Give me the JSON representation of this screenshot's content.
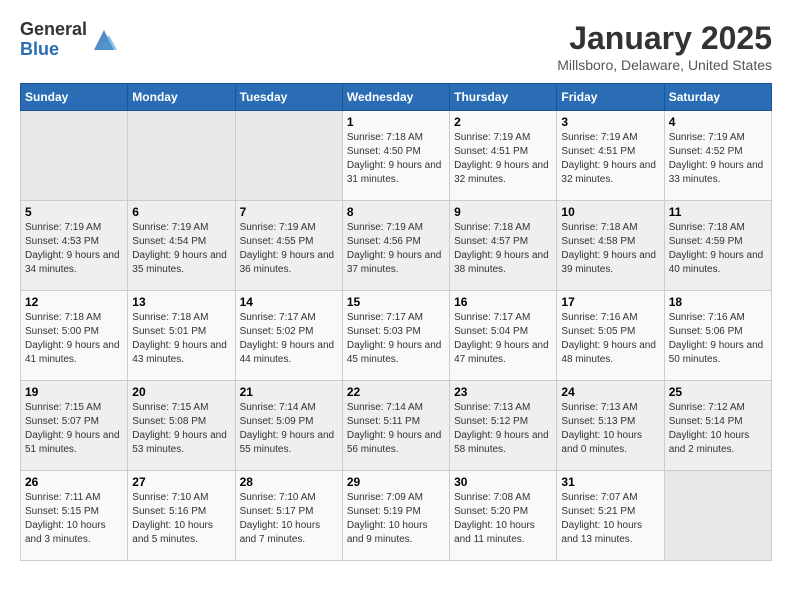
{
  "header": {
    "logo_general": "General",
    "logo_blue": "Blue",
    "title": "January 2025",
    "location": "Millsboro, Delaware, United States"
  },
  "weekdays": [
    "Sunday",
    "Monday",
    "Tuesday",
    "Wednesday",
    "Thursday",
    "Friday",
    "Saturday"
  ],
  "weeks": [
    [
      {
        "day": "",
        "info": ""
      },
      {
        "day": "",
        "info": ""
      },
      {
        "day": "",
        "info": ""
      },
      {
        "day": "1",
        "info": "Sunrise: 7:18 AM\nSunset: 4:50 PM\nDaylight: 9 hours and 31 minutes."
      },
      {
        "day": "2",
        "info": "Sunrise: 7:19 AM\nSunset: 4:51 PM\nDaylight: 9 hours and 32 minutes."
      },
      {
        "day": "3",
        "info": "Sunrise: 7:19 AM\nSunset: 4:51 PM\nDaylight: 9 hours and 32 minutes."
      },
      {
        "day": "4",
        "info": "Sunrise: 7:19 AM\nSunset: 4:52 PM\nDaylight: 9 hours and 33 minutes."
      }
    ],
    [
      {
        "day": "5",
        "info": "Sunrise: 7:19 AM\nSunset: 4:53 PM\nDaylight: 9 hours and 34 minutes."
      },
      {
        "day": "6",
        "info": "Sunrise: 7:19 AM\nSunset: 4:54 PM\nDaylight: 9 hours and 35 minutes."
      },
      {
        "day": "7",
        "info": "Sunrise: 7:19 AM\nSunset: 4:55 PM\nDaylight: 9 hours and 36 minutes."
      },
      {
        "day": "8",
        "info": "Sunrise: 7:19 AM\nSunset: 4:56 PM\nDaylight: 9 hours and 37 minutes."
      },
      {
        "day": "9",
        "info": "Sunrise: 7:18 AM\nSunset: 4:57 PM\nDaylight: 9 hours and 38 minutes."
      },
      {
        "day": "10",
        "info": "Sunrise: 7:18 AM\nSunset: 4:58 PM\nDaylight: 9 hours and 39 minutes."
      },
      {
        "day": "11",
        "info": "Sunrise: 7:18 AM\nSunset: 4:59 PM\nDaylight: 9 hours and 40 minutes."
      }
    ],
    [
      {
        "day": "12",
        "info": "Sunrise: 7:18 AM\nSunset: 5:00 PM\nDaylight: 9 hours and 41 minutes."
      },
      {
        "day": "13",
        "info": "Sunrise: 7:18 AM\nSunset: 5:01 PM\nDaylight: 9 hours and 43 minutes."
      },
      {
        "day": "14",
        "info": "Sunrise: 7:17 AM\nSunset: 5:02 PM\nDaylight: 9 hours and 44 minutes."
      },
      {
        "day": "15",
        "info": "Sunrise: 7:17 AM\nSunset: 5:03 PM\nDaylight: 9 hours and 45 minutes."
      },
      {
        "day": "16",
        "info": "Sunrise: 7:17 AM\nSunset: 5:04 PM\nDaylight: 9 hours and 47 minutes."
      },
      {
        "day": "17",
        "info": "Sunrise: 7:16 AM\nSunset: 5:05 PM\nDaylight: 9 hours and 48 minutes."
      },
      {
        "day": "18",
        "info": "Sunrise: 7:16 AM\nSunset: 5:06 PM\nDaylight: 9 hours and 50 minutes."
      }
    ],
    [
      {
        "day": "19",
        "info": "Sunrise: 7:15 AM\nSunset: 5:07 PM\nDaylight: 9 hours and 51 minutes."
      },
      {
        "day": "20",
        "info": "Sunrise: 7:15 AM\nSunset: 5:08 PM\nDaylight: 9 hours and 53 minutes."
      },
      {
        "day": "21",
        "info": "Sunrise: 7:14 AM\nSunset: 5:09 PM\nDaylight: 9 hours and 55 minutes."
      },
      {
        "day": "22",
        "info": "Sunrise: 7:14 AM\nSunset: 5:11 PM\nDaylight: 9 hours and 56 minutes."
      },
      {
        "day": "23",
        "info": "Sunrise: 7:13 AM\nSunset: 5:12 PM\nDaylight: 9 hours and 58 minutes."
      },
      {
        "day": "24",
        "info": "Sunrise: 7:13 AM\nSunset: 5:13 PM\nDaylight: 10 hours and 0 minutes."
      },
      {
        "day": "25",
        "info": "Sunrise: 7:12 AM\nSunset: 5:14 PM\nDaylight: 10 hours and 2 minutes."
      }
    ],
    [
      {
        "day": "26",
        "info": "Sunrise: 7:11 AM\nSunset: 5:15 PM\nDaylight: 10 hours and 3 minutes."
      },
      {
        "day": "27",
        "info": "Sunrise: 7:10 AM\nSunset: 5:16 PM\nDaylight: 10 hours and 5 minutes."
      },
      {
        "day": "28",
        "info": "Sunrise: 7:10 AM\nSunset: 5:17 PM\nDaylight: 10 hours and 7 minutes."
      },
      {
        "day": "29",
        "info": "Sunrise: 7:09 AM\nSunset: 5:19 PM\nDaylight: 10 hours and 9 minutes."
      },
      {
        "day": "30",
        "info": "Sunrise: 7:08 AM\nSunset: 5:20 PM\nDaylight: 10 hours and 11 minutes."
      },
      {
        "day": "31",
        "info": "Sunrise: 7:07 AM\nSunset: 5:21 PM\nDaylight: 10 hours and 13 minutes."
      },
      {
        "day": "",
        "info": ""
      }
    ]
  ]
}
